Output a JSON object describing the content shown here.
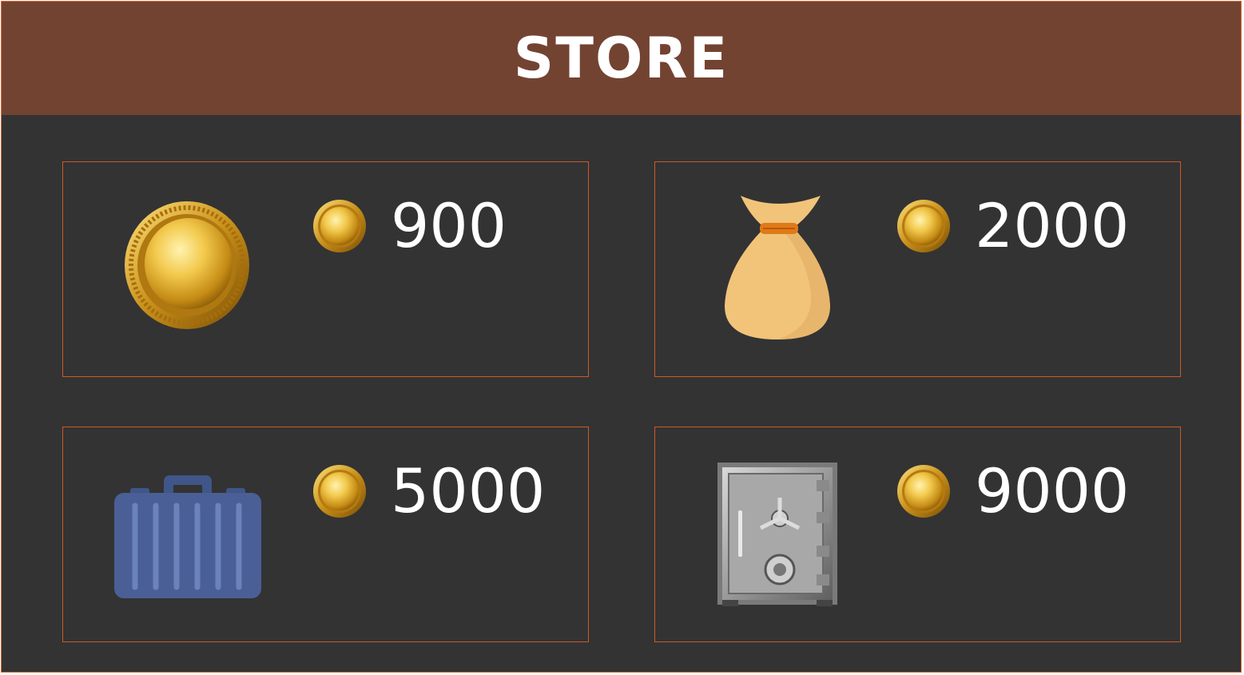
{
  "store": {
    "title": "STORE",
    "items": [
      {
        "icon": "gold-coin-icon",
        "price": "900"
      },
      {
        "icon": "money-bag-icon",
        "price": "2000"
      },
      {
        "icon": "briefcase-icon",
        "price": "5000"
      },
      {
        "icon": "safe-vault-icon",
        "price": "9000"
      }
    ]
  },
  "colors": {
    "header_bg": "#734332",
    "panel_bg": "#333333",
    "card_border": "#cc5a24",
    "text": "#ffffff"
  }
}
